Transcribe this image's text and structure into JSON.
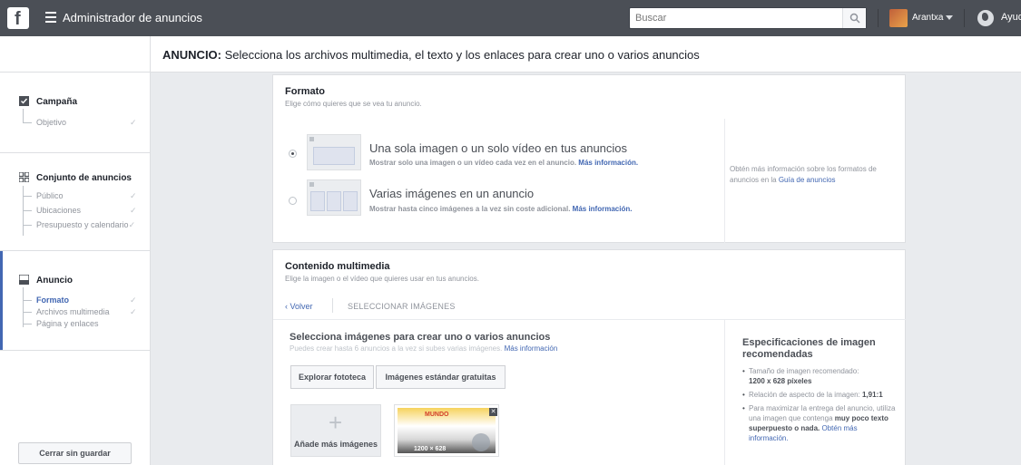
{
  "topbar": {
    "logo": "f",
    "app_title": "Administrador de anuncios",
    "search_placeholder": "Buscar",
    "user_name": "Arantxa",
    "help": "Ayud"
  },
  "header": {
    "label_bold": "ANUNCIO:",
    "text": "Selecciona los archivos multimedia, el texto y los enlaces para crear uno o varios anuncios"
  },
  "sidebar": {
    "sections": [
      {
        "title": "Campaña",
        "icon": "checkbox-icon",
        "items": [
          {
            "label": "Objetivo",
            "done": true
          }
        ]
      },
      {
        "title": "Conjunto de anuncios",
        "icon": "grid-icon",
        "items": [
          {
            "label": "Público",
            "done": true
          },
          {
            "label": "Ubicaciones",
            "done": true
          },
          {
            "label": "Presupuesto y calendario",
            "done": true
          }
        ]
      },
      {
        "title": "Anuncio",
        "icon": "ad-icon",
        "items": [
          {
            "label": "Formato",
            "done": true,
            "active": true
          },
          {
            "label": "Archivos multimedia",
            "done": true
          },
          {
            "label": "Página y enlaces",
            "done": false
          }
        ]
      }
    ],
    "close_button": "Cerrar sin guardar",
    "check_glyph": "✓"
  },
  "format": {
    "title": "Formato",
    "subtitle": "Elige cómo quieres que se vea tu anuncio.",
    "options": [
      {
        "title": "Una sola imagen o un solo vídeo en tus anuncios",
        "desc": "Mostrar solo una imagen o un vídeo cada vez en el anuncio.",
        "link": "Más información.",
        "selected": true
      },
      {
        "title": "Varias imágenes en un anuncio",
        "desc": "Mostrar hasta cinco imágenes a la vez sin coste adicional.",
        "link": "Más información.",
        "selected": false
      }
    ],
    "side_info": "Obtén más información sobre los formatos de anuncios en la",
    "side_link": "Guía de anuncios"
  },
  "media": {
    "title": "Contenido multimedia",
    "subtitle": "Elige la imagen o el vídeo que quieres usar en tus anuncios.",
    "back": "Volver",
    "crumb": "SELECCIONAR IMÁGENES",
    "select_title": "Selecciona imágenes para crear uno o varios anuncios",
    "select_sub": "Puedes crear hasta 6 anuncios a la vez si subes varias imágenes.",
    "select_link": "Más información",
    "btn_library": "Explorar fototeca",
    "btn_stock": "Imágenes estándar gratuitas",
    "add_more": "Añade más imágenes",
    "add_plus": "+",
    "image_dims": "1200 × 628",
    "image_brand": "MUNDO",
    "image_remove": "✕"
  },
  "specs": {
    "title": "Especificaciones de imagen recomendadas",
    "items": [
      {
        "text": "Tamaño de imagen recomendado:",
        "bold": "1200 x 628 píxeles"
      },
      {
        "text": "Relación de aspecto de la imagen:",
        "bold": "1,91:1"
      }
    ],
    "item3_text": "Para maximizar la entrega del anuncio, utiliza una imagen que contenga",
    "item3_bold": "muy poco texto superpuesto o nada.",
    "item3_link": "Obtén más información."
  }
}
